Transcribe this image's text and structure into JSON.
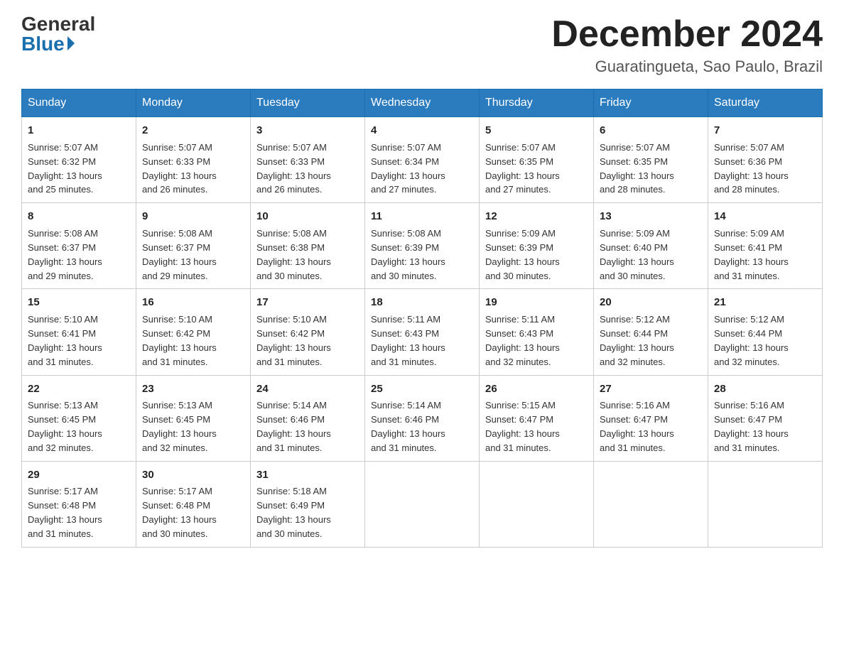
{
  "logo": {
    "general": "General",
    "blue": "Blue"
  },
  "title": "December 2024",
  "subtitle": "Guaratingueta, Sao Paulo, Brazil",
  "days_of_week": [
    "Sunday",
    "Monday",
    "Tuesday",
    "Wednesday",
    "Thursday",
    "Friday",
    "Saturday"
  ],
  "weeks": [
    [
      {
        "day": "1",
        "sunrise": "5:07 AM",
        "sunset": "6:32 PM",
        "daylight": "13 hours and 25 minutes."
      },
      {
        "day": "2",
        "sunrise": "5:07 AM",
        "sunset": "6:33 PM",
        "daylight": "13 hours and 26 minutes."
      },
      {
        "day": "3",
        "sunrise": "5:07 AM",
        "sunset": "6:33 PM",
        "daylight": "13 hours and 26 minutes."
      },
      {
        "day": "4",
        "sunrise": "5:07 AM",
        "sunset": "6:34 PM",
        "daylight": "13 hours and 27 minutes."
      },
      {
        "day": "5",
        "sunrise": "5:07 AM",
        "sunset": "6:35 PM",
        "daylight": "13 hours and 27 minutes."
      },
      {
        "day": "6",
        "sunrise": "5:07 AM",
        "sunset": "6:35 PM",
        "daylight": "13 hours and 28 minutes."
      },
      {
        "day": "7",
        "sunrise": "5:07 AM",
        "sunset": "6:36 PM",
        "daylight": "13 hours and 28 minutes."
      }
    ],
    [
      {
        "day": "8",
        "sunrise": "5:08 AM",
        "sunset": "6:37 PM",
        "daylight": "13 hours and 29 minutes."
      },
      {
        "day": "9",
        "sunrise": "5:08 AM",
        "sunset": "6:37 PM",
        "daylight": "13 hours and 29 minutes."
      },
      {
        "day": "10",
        "sunrise": "5:08 AM",
        "sunset": "6:38 PM",
        "daylight": "13 hours and 30 minutes."
      },
      {
        "day": "11",
        "sunrise": "5:08 AM",
        "sunset": "6:39 PM",
        "daylight": "13 hours and 30 minutes."
      },
      {
        "day": "12",
        "sunrise": "5:09 AM",
        "sunset": "6:39 PM",
        "daylight": "13 hours and 30 minutes."
      },
      {
        "day": "13",
        "sunrise": "5:09 AM",
        "sunset": "6:40 PM",
        "daylight": "13 hours and 30 minutes."
      },
      {
        "day": "14",
        "sunrise": "5:09 AM",
        "sunset": "6:41 PM",
        "daylight": "13 hours and 31 minutes."
      }
    ],
    [
      {
        "day": "15",
        "sunrise": "5:10 AM",
        "sunset": "6:41 PM",
        "daylight": "13 hours and 31 minutes."
      },
      {
        "day": "16",
        "sunrise": "5:10 AM",
        "sunset": "6:42 PM",
        "daylight": "13 hours and 31 minutes."
      },
      {
        "day": "17",
        "sunrise": "5:10 AM",
        "sunset": "6:42 PM",
        "daylight": "13 hours and 31 minutes."
      },
      {
        "day": "18",
        "sunrise": "5:11 AM",
        "sunset": "6:43 PM",
        "daylight": "13 hours and 31 minutes."
      },
      {
        "day": "19",
        "sunrise": "5:11 AM",
        "sunset": "6:43 PM",
        "daylight": "13 hours and 32 minutes."
      },
      {
        "day": "20",
        "sunrise": "5:12 AM",
        "sunset": "6:44 PM",
        "daylight": "13 hours and 32 minutes."
      },
      {
        "day": "21",
        "sunrise": "5:12 AM",
        "sunset": "6:44 PM",
        "daylight": "13 hours and 32 minutes."
      }
    ],
    [
      {
        "day": "22",
        "sunrise": "5:13 AM",
        "sunset": "6:45 PM",
        "daylight": "13 hours and 32 minutes."
      },
      {
        "day": "23",
        "sunrise": "5:13 AM",
        "sunset": "6:45 PM",
        "daylight": "13 hours and 32 minutes."
      },
      {
        "day": "24",
        "sunrise": "5:14 AM",
        "sunset": "6:46 PM",
        "daylight": "13 hours and 31 minutes."
      },
      {
        "day": "25",
        "sunrise": "5:14 AM",
        "sunset": "6:46 PM",
        "daylight": "13 hours and 31 minutes."
      },
      {
        "day": "26",
        "sunrise": "5:15 AM",
        "sunset": "6:47 PM",
        "daylight": "13 hours and 31 minutes."
      },
      {
        "day": "27",
        "sunrise": "5:16 AM",
        "sunset": "6:47 PM",
        "daylight": "13 hours and 31 minutes."
      },
      {
        "day": "28",
        "sunrise": "5:16 AM",
        "sunset": "6:47 PM",
        "daylight": "13 hours and 31 minutes."
      }
    ],
    [
      {
        "day": "29",
        "sunrise": "5:17 AM",
        "sunset": "6:48 PM",
        "daylight": "13 hours and 31 minutes."
      },
      {
        "day": "30",
        "sunrise": "5:17 AM",
        "sunset": "6:48 PM",
        "daylight": "13 hours and 30 minutes."
      },
      {
        "day": "31",
        "sunrise": "5:18 AM",
        "sunset": "6:49 PM",
        "daylight": "13 hours and 30 minutes."
      },
      null,
      null,
      null,
      null
    ]
  ],
  "labels": {
    "sunrise": "Sunrise:",
    "sunset": "Sunset:",
    "daylight": "Daylight:"
  }
}
